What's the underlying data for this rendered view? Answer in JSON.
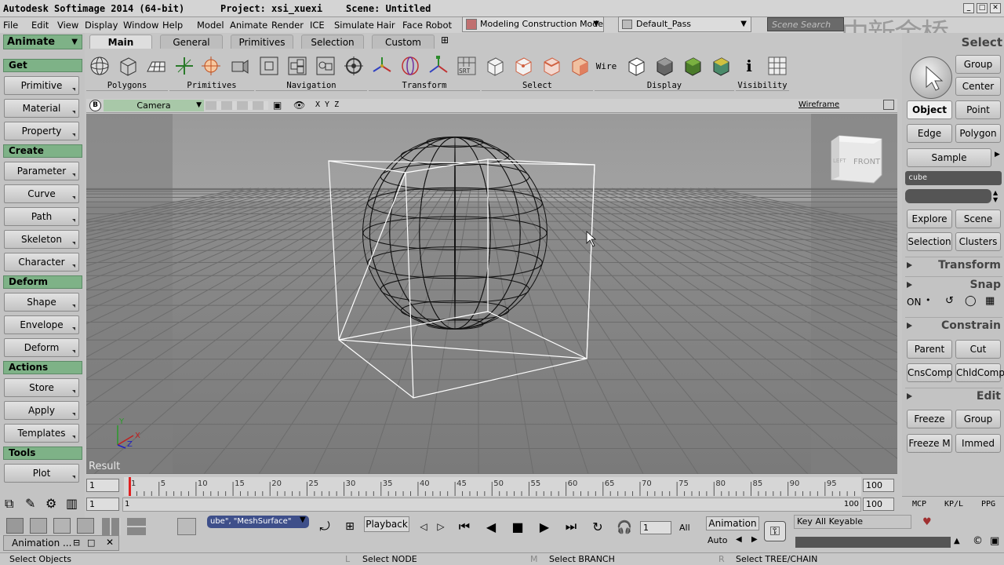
{
  "titlebar": {
    "app": "Autodesk Softimage 2014 (64-bit)",
    "project": "Project: xsi_xuexi",
    "scene": "Scene: Untitled"
  },
  "menu": [
    "File",
    "Edit",
    "View",
    "Display",
    "Window",
    "Help",
    "Model",
    "Animate",
    "Render",
    "ICE",
    "Simulate",
    "Hair",
    "Face Robot"
  ],
  "mode_combo": "Modeling Construction Mode",
  "pass_combo": "Default_Pass",
  "search_placeholder": "Scene Search",
  "watermark": "中新金桥",
  "left": {
    "mode": "Animate",
    "groups": [
      {
        "head": "Get",
        "items": [
          "Primitive",
          "Material",
          "Property"
        ]
      },
      {
        "head": "Create",
        "items": [
          "Parameter",
          "Curve",
          "Path",
          "Skeleton",
          "Character"
        ]
      },
      {
        "head": "Deform",
        "items": [
          "Shape",
          "Envelope",
          "Deform"
        ]
      },
      {
        "head": "Actions",
        "items": [
          "Store",
          "Apply",
          "Templates"
        ]
      },
      {
        "head": "Tools",
        "items": [
          "Plot"
        ]
      }
    ]
  },
  "tabs": [
    "Main",
    "General",
    "Primitives",
    "Selection",
    "Custom"
  ],
  "toolbar_groups": [
    "Polygons",
    "Primitives",
    "Navigation",
    "Transform",
    "Select",
    "Display",
    "Visibility"
  ],
  "toolbar_wire": "Wire",
  "toolbar_srt": "SRT",
  "toolbar_info": "i",
  "viewport": {
    "badge": "B",
    "camera": "Camera",
    "axes": "X Y Z",
    "shading": "Wireframe",
    "result": "Result",
    "cube_face": "FRONT",
    "cube_side": "LEFT"
  },
  "right": {
    "title": "Select",
    "btns_top": [
      "Group",
      "Center",
      "Object",
      "Point",
      "Edge",
      "Polygon",
      "Sample"
    ],
    "name_field": "cube",
    "btns_mid": [
      "Explore",
      "Scene",
      "Selection",
      "Clusters"
    ],
    "transform": "Transform",
    "snap": "Snap",
    "snap_on": "ON",
    "constrain": "Constrain",
    "btns_constrain": [
      "Parent",
      "Cut",
      "CnsComp",
      "ChldComp"
    ],
    "edit": "Edit",
    "btns_edit": [
      "Freeze",
      "Group",
      "Freeze M",
      "Immed"
    ],
    "tabs_bottom": [
      "MCP",
      "KP/L",
      "PPG"
    ]
  },
  "timeline": {
    "start": "1",
    "end": "100",
    "ticks": [
      "1",
      "5",
      "10",
      "15",
      "20",
      "25",
      "30",
      "35",
      "40",
      "45",
      "50",
      "55",
      "60",
      "65",
      "70",
      "75",
      "80",
      "85",
      "90",
      "95"
    ],
    "range_start": "1",
    "range_end": "100",
    "range_end2": "100",
    "range_end3": "100",
    "range_label_start": "1"
  },
  "bottom": {
    "script": "ube\", \"MeshSurface\"",
    "playback": "Playback",
    "frame": "1",
    "all": "All",
    "animation": "Animation",
    "auto": "Auto",
    "keyall": "Key All Keyable",
    "panel": "Animation ..."
  },
  "status": {
    "left": "Select Objects",
    "l": "L",
    "l_text": "Select NODE",
    "m": "M",
    "m_text": "Select BRANCH",
    "r": "R",
    "r_text": "Select TREE/CHAIN"
  }
}
